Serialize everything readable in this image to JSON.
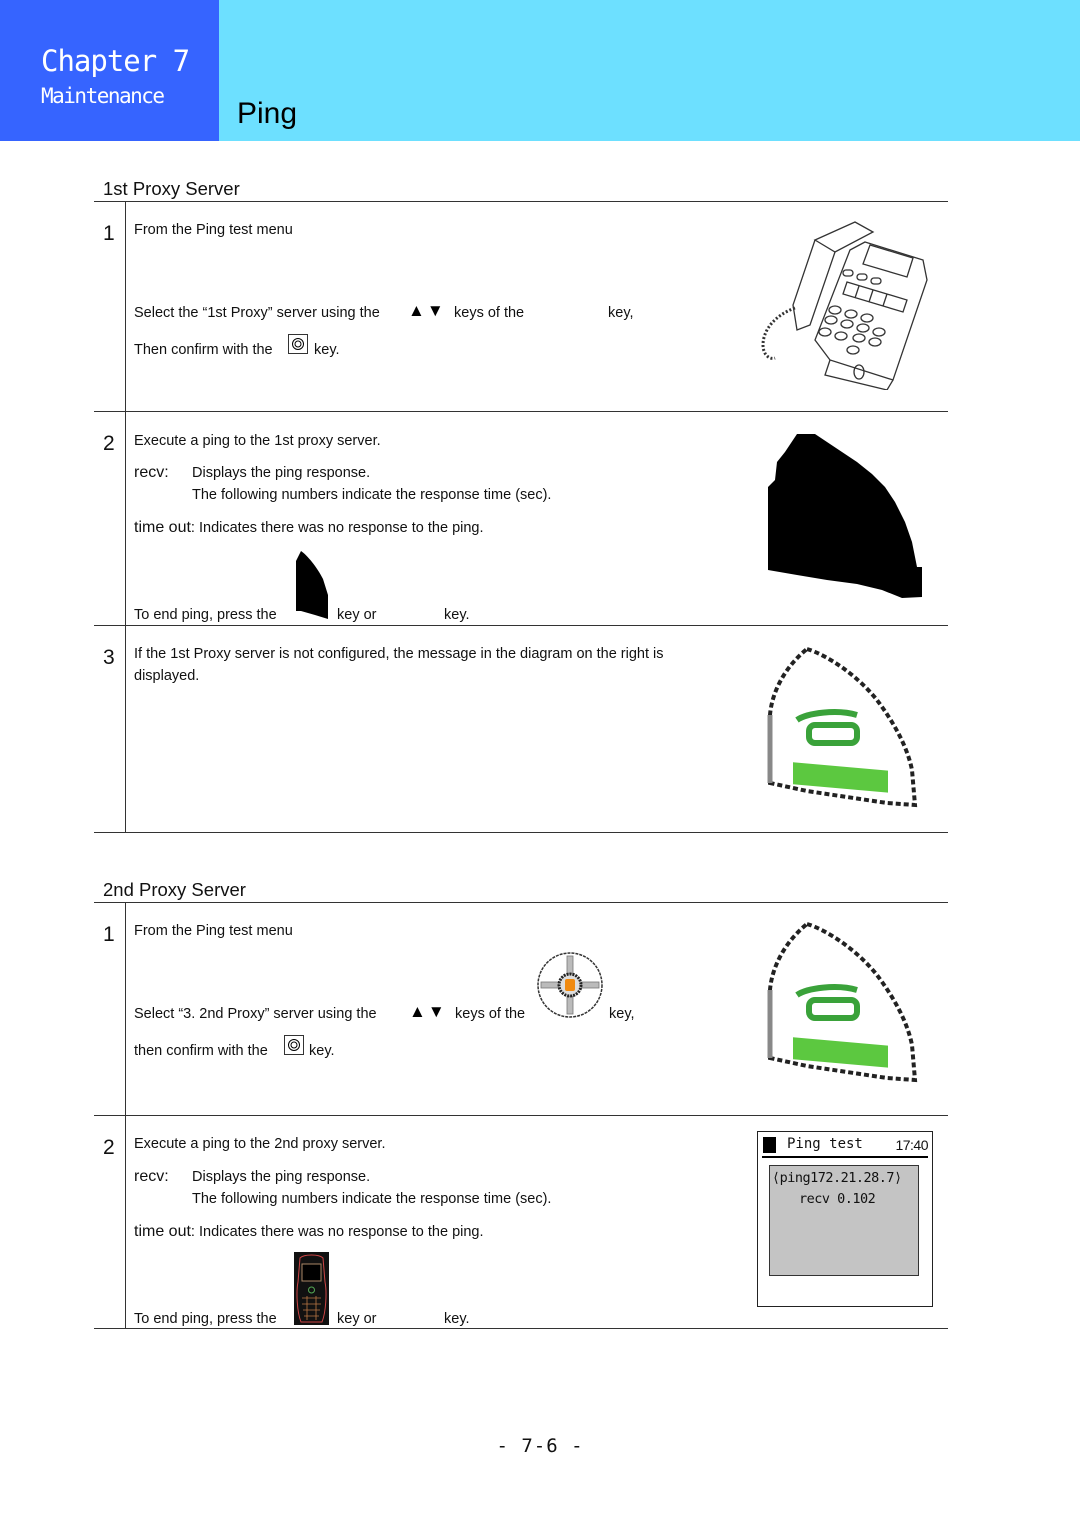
{
  "header": {
    "chapter": "Chapter 7",
    "chapter_subtitle": "Maintenance",
    "page_title": "Ping",
    "colors": {
      "chapter_bg": "#3664ff",
      "title_bg": "#6de0ff"
    }
  },
  "sections": [
    {
      "title": "1st Proxy Server",
      "steps": [
        {
          "number": "1",
          "lines": [
            "From the Ping test menu",
            "Select the “1st Proxy” server using the",
            "keys of the",
            "key,",
            "Then confirm with the",
            "key."
          ],
          "icons": [
            "up-down-arrow-keys",
            "ok-key",
            "desk-phone-illustration"
          ]
        },
        {
          "number": "2",
          "lines": [
            "Execute a ping to the 1st proxy server.",
            "recv:",
            "Displays the ping response.",
            "The following numbers indicate the response time (sec).",
            "time out",
            ": Indicates there was no response to the ping.",
            "To end ping, press the",
            "key or",
            "key."
          ],
          "icons": [
            "end-key",
            "screen-illustration"
          ]
        },
        {
          "number": "3",
          "lines": [
            "If the 1st Proxy server is not configured, the message in the diagram on the right is",
            "displayed."
          ],
          "icons": [
            "send-key-illustration"
          ]
        }
      ]
    },
    {
      "title": "2nd Proxy Server",
      "steps": [
        {
          "number": "1",
          "lines": [
            "From the Ping test menu",
            "Select  “3. 2nd Proxy” server using the",
            "keys of the",
            "key,",
            "then confirm with the",
            "key."
          ],
          "icons": [
            "up-down-arrow-keys",
            "navigation-key",
            "ok-key",
            "send-key-illustration"
          ]
        },
        {
          "number": "2",
          "lines": [
            "Execute a ping to the 2nd proxy server.",
            "recv:",
            "Displays the ping response.",
            "The following numbers indicate the response time (sec).",
            "time out",
            ": Indicates there was no response to the ping.",
            "To end ping, press the",
            "key or",
            "key."
          ],
          "icons": [
            "mobile-phone-key"
          ],
          "lcd": {
            "title": "Ping test",
            "time": "17:40",
            "line1": "⟨ping172.21.28.7⟩",
            "line2": "recv  0.102"
          }
        }
      ]
    }
  ],
  "glyphs": {
    "arrows": "▲▼",
    "ok": "◎"
  },
  "footer": {
    "page_number": "- 7-6 -"
  }
}
